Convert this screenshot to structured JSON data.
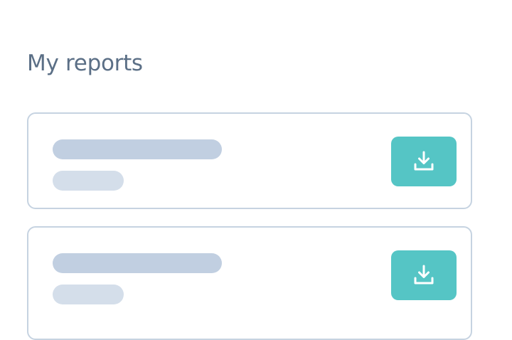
{
  "page": {
    "title": "My reports"
  },
  "theme": {
    "title_color": "#5b6f86",
    "card_border": "#c6d3e1",
    "skeleton_primary": "#c1cfe1",
    "skeleton_secondary": "#d4deea",
    "accent": "#55c5c5"
  },
  "reports": [
    {
      "state": "loading-placeholder",
      "action_icon": "download-icon"
    },
    {
      "state": "loading-placeholder",
      "action_icon": "download-icon"
    }
  ]
}
